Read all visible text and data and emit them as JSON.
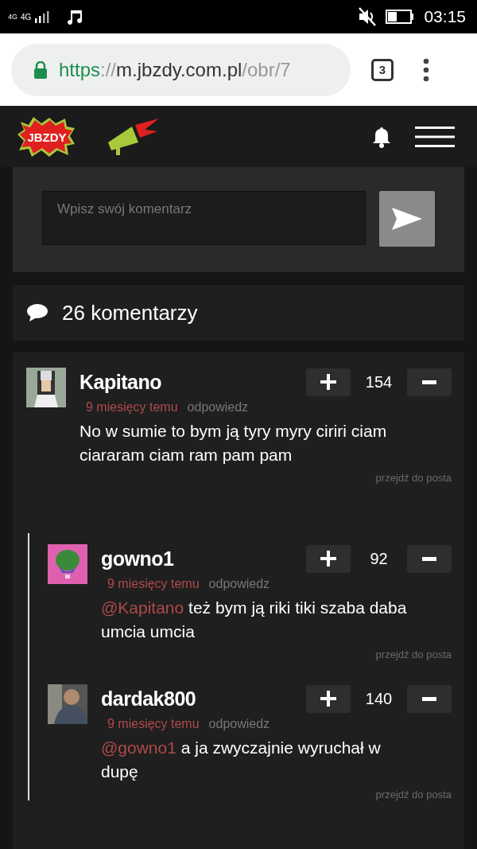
{
  "status_bar": {
    "network_top": "4G",
    "network": "4G",
    "time": "03:15"
  },
  "browser": {
    "url": {
      "scheme": "https",
      "separator": "://",
      "host": "m.jbzdy.com.pl",
      "path": "/obr/7"
    },
    "tab_count": "3"
  },
  "site_header": {
    "logo": "JBZDY"
  },
  "comment_form": {
    "placeholder": "Wpisz swój komentarz"
  },
  "comments_header": {
    "count": "26 komentarzy"
  },
  "comments": [
    {
      "author": "Kapitano",
      "score": "154",
      "time": "9 miesięcy temu",
      "reply": "odpowiedz",
      "text": "No w sumie to bym ją tyry myry ciriri ciam ciararam ciam ram pam pam",
      "goto": "przejdź do posta",
      "children": [
        {
          "author": "gowno1",
          "score": "92",
          "time": "9 miesięcy temu",
          "reply": "odpowiedz",
          "mention": "@Kapitano",
          "text": "też bym ją riki tiki szaba daba umcia umcia",
          "goto": "przejdź do posta"
        },
        {
          "author": "dardak800",
          "score": "140",
          "time": "9 miesięcy temu",
          "reply": "odpowiedz",
          "mention": "@gowno1",
          "text": "a ja zwyczajnie wyruchał w dupę",
          "goto": "przejdź do posta"
        }
      ]
    }
  ]
}
